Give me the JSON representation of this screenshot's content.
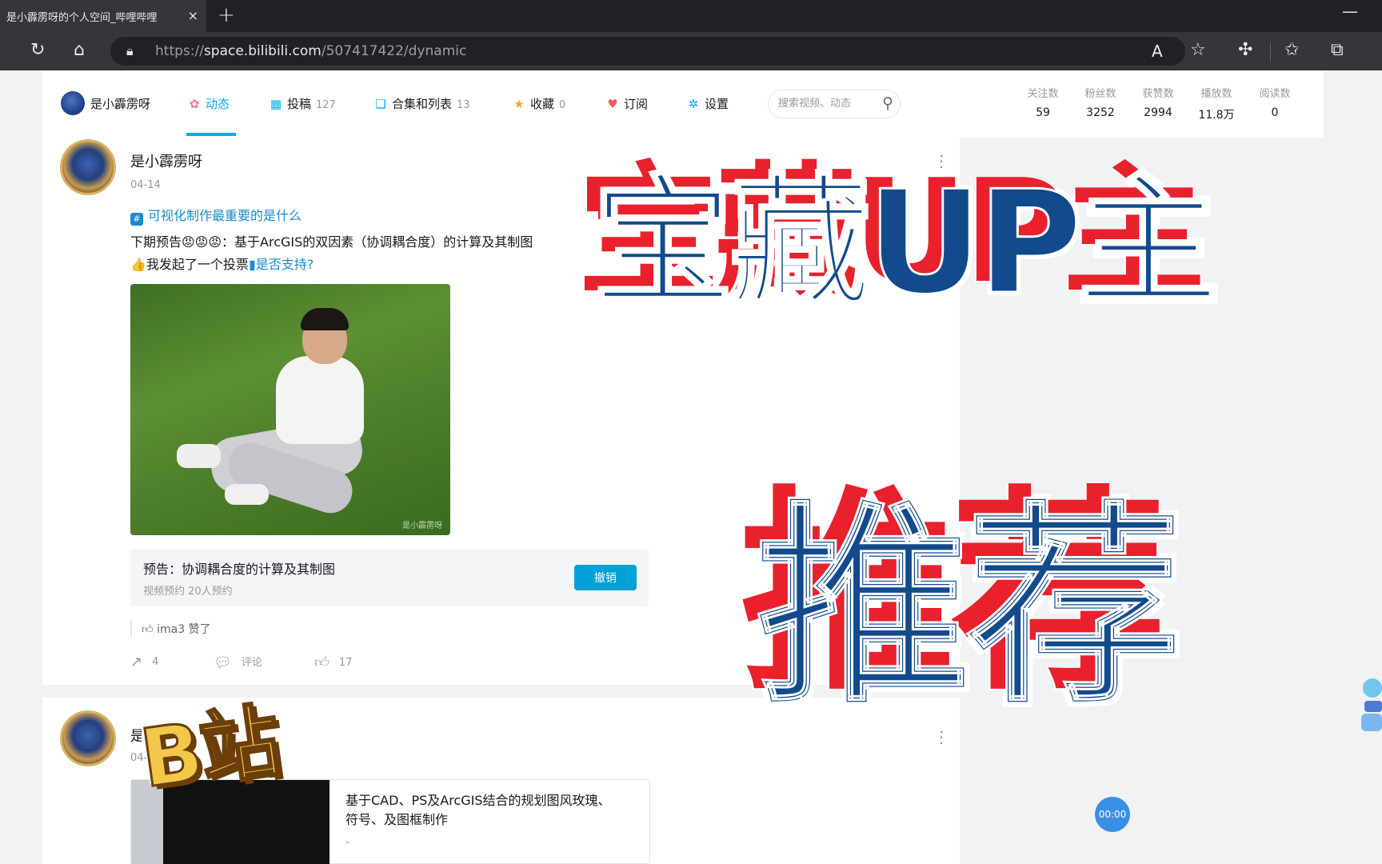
{
  "browser": {
    "tab_title": "是小霹雳呀的个人空间_哔哩哔哩",
    "tab_close": "×",
    "new_tab": "+",
    "url_scheme": "https://",
    "url_host": "space.bilibili.com",
    "url_path": "/507417422/dynamic"
  },
  "header": {
    "username": "是小霹雳呀",
    "nav": [
      {
        "label": "动态",
        "count": "",
        "icon": "dynamic-icon",
        "glyph": "✿",
        "color": "#fb7299"
      },
      {
        "label": "投稿",
        "count": "127",
        "icon": "upload-icon",
        "glyph": "▦",
        "color": "#00aeec"
      },
      {
        "label": "合集和列表",
        "count": "13",
        "icon": "collection-icon",
        "glyph": "❏",
        "color": "#00aeec"
      },
      {
        "label": "收藏",
        "count": "0",
        "icon": "favorites-icon",
        "glyph": "★",
        "color": "#f6a623"
      },
      {
        "label": "订阅",
        "count": "",
        "icon": "subscribe-icon",
        "glyph": "♥",
        "color": "#f25d52"
      },
      {
        "label": "设置",
        "count": "",
        "icon": "settings-icon",
        "glyph": "✲",
        "color": "#00aeec"
      }
    ],
    "search_placeholder": "搜索视频、动态",
    "stats": [
      {
        "label": "关注数",
        "value": "59"
      },
      {
        "label": "粉丝数",
        "value": "3252"
      },
      {
        "label": "获赞数",
        "value": "2994"
      },
      {
        "label": "播放数",
        "value": "11.8万"
      },
      {
        "label": "阅读数",
        "value": "0"
      }
    ]
  },
  "post1": {
    "author": "是小霹雳呀",
    "date": "04-14",
    "topic": "可视化制作最重要的是什么",
    "line1": "下期预告😡😡😡：基于ArcGIS的双因素（协调耦合度）的计算及其制图",
    "line2_prefix": "👍我发起了一个投票",
    "line2_link": "是否支持?",
    "image_watermark": "是小霹雳呀",
    "reserve_title": "预告：协调耦合度的计算及其制图",
    "reserve_meta": "视频预约   20人预约",
    "reserve_button": "撤销",
    "liked_by": "ima3 赞了",
    "share_count": "4",
    "comment_label": "评论",
    "like_count": "17"
  },
  "post2": {
    "author": "是小霹雳呀",
    "date": "04-",
    "video_title": "基于CAD、PS及ArcGIS结合的规划图风玫瑰、符号、及图框制作",
    "video_extra": "-"
  },
  "player_timer": "00:00",
  "overlay": {
    "main": "宝藏UP主",
    "sub": "推荐",
    "badge": "B站"
  }
}
